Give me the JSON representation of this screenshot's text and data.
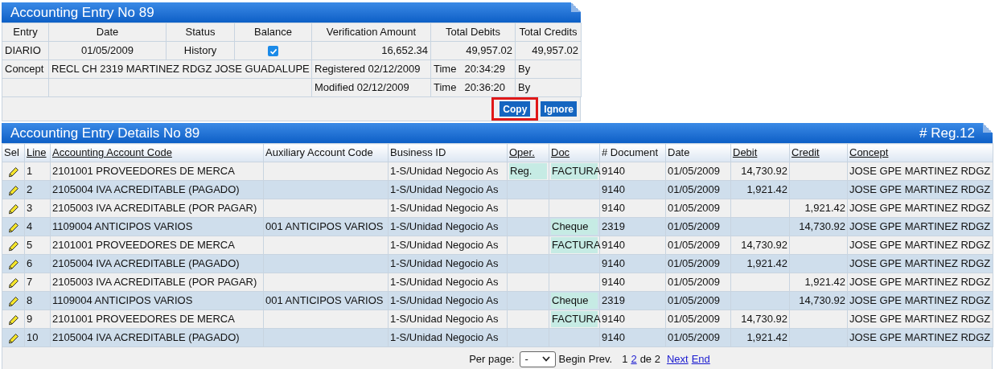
{
  "entry_panel": {
    "title": "Accounting Entry No 89",
    "columns": [
      "Entry",
      "Date",
      "Status",
      "Balance",
      "Verification Amount",
      "Total Debits",
      "Total Credits"
    ],
    "entry": "DIARIO",
    "date": "01/05/2009",
    "status": "History",
    "balanced": true,
    "verification_amount": "16,652.34",
    "total_debits": "49,957.02",
    "total_credits": "49,957.02",
    "concept_label": "Concept",
    "concept": "RECL CH 2319 MARTINEZ RDGZ JOSE GUADALUPE",
    "registered": "Registered 02/12/2009",
    "registered_time_label": "Time",
    "registered_time": "20:34:29",
    "registered_by": "By",
    "modified": "Modified 02/12/2009",
    "modified_time_label": "Time",
    "modified_time": "20:36:20",
    "modified_by": "By",
    "buttons": [
      {
        "label": "Copy",
        "highlighted": true
      },
      {
        "label": "Ignore",
        "highlighted": false
      }
    ]
  },
  "details_panel": {
    "title": "Accounting Entry Details No 89",
    "count": "# Reg.12",
    "columns": [
      {
        "label": "Sel",
        "sortable": false
      },
      {
        "label": "Line",
        "sortable": true
      },
      {
        "label": "Accounting Account Code",
        "sortable": true
      },
      {
        "label": "Auxiliary Account Code",
        "sortable": false
      },
      {
        "label": "Business ID",
        "sortable": false
      },
      {
        "label": "Oper.",
        "sortable": true
      },
      {
        "label": "Doc",
        "sortable": true
      },
      {
        "label": "# Document",
        "sortable": false
      },
      {
        "label": "Date",
        "sortable": false
      },
      {
        "label": "Debit",
        "sortable": true
      },
      {
        "label": "Credit",
        "sortable": true
      },
      {
        "label": "Concept",
        "sortable": true
      }
    ],
    "rows": [
      {
        "line": "1",
        "account": "2101001 PROVEEDORES DE MERCA",
        "auxiliary": "",
        "business": "1-S/Unidad Negocio As",
        "oper": "Reg.",
        "doc": "FACTURA",
        "document": "9140",
        "date": "01/05/2009",
        "debit": "14,730.92",
        "credit": "",
        "concept": "JOSE GPE MARTINEZ RDGZ"
      },
      {
        "line": "2",
        "account": "2105004 IVA ACREDITABLE (PAGADO)",
        "auxiliary": "",
        "business": "1-S/Unidad Negocio As",
        "oper": "",
        "doc": "",
        "document": "9140",
        "date": "01/05/2009",
        "debit": "1,921.42",
        "credit": "",
        "concept": "JOSE GPE MARTINEZ RDGZ"
      },
      {
        "line": "3",
        "account": "2105003 IVA ACREDITABLE (POR PAGAR)",
        "auxiliary": "",
        "business": "1-S/Unidad Negocio As",
        "oper": "",
        "doc": "",
        "document": "9140",
        "date": "01/05/2009",
        "debit": "",
        "credit": "1,921.42",
        "concept": "JOSE GPE MARTINEZ RDGZ"
      },
      {
        "line": "4",
        "account": "1109004 ANTICIPOS VARIOS",
        "auxiliary": "001 ANTICIPOS VARIOS",
        "business": "1-S/Unidad Negocio As",
        "oper": "",
        "doc": "Cheque",
        "document": "2319",
        "date": "01/05/2009",
        "debit": "",
        "credit": "14,730.92",
        "concept": "JOSE GPE MARTINEZ RDGZ"
      },
      {
        "line": "5",
        "account": "2101001 PROVEEDORES DE MERCA",
        "auxiliary": "",
        "business": "1-S/Unidad Negocio As",
        "oper": "",
        "doc": "FACTURA",
        "document": "9140",
        "date": "01/05/2009",
        "debit": "14,730.92",
        "credit": "",
        "concept": "JOSE GPE MARTINEZ RDGZ"
      },
      {
        "line": "6",
        "account": "2105004 IVA ACREDITABLE (PAGADO)",
        "auxiliary": "",
        "business": "1-S/Unidad Negocio As",
        "oper": "",
        "doc": "",
        "document": "9140",
        "date": "01/05/2009",
        "debit": "1,921.42",
        "credit": "",
        "concept": "JOSE GPE MARTINEZ RDGZ"
      },
      {
        "line": "7",
        "account": "2105003 IVA ACREDITABLE (POR PAGAR)",
        "auxiliary": "",
        "business": "1-S/Unidad Negocio As",
        "oper": "",
        "doc": "",
        "document": "9140",
        "date": "01/05/2009",
        "debit": "",
        "credit": "1,921.42",
        "concept": "JOSE GPE MARTINEZ RDGZ"
      },
      {
        "line": "8",
        "account": "1109004 ANTICIPOS VARIOS",
        "auxiliary": "001 ANTICIPOS VARIOS",
        "business": "1-S/Unidad Negocio As",
        "oper": "",
        "doc": "Cheque",
        "document": "2319",
        "date": "01/05/2009",
        "debit": "",
        "credit": "14,730.92",
        "concept": "JOSE GPE MARTINEZ RDGZ"
      },
      {
        "line": "9",
        "account": "2101001 PROVEEDORES DE MERCA",
        "auxiliary": "",
        "business": "1-S/Unidad Negocio As",
        "oper": "",
        "doc": "FACTURA",
        "document": "9140",
        "date": "01/05/2009",
        "debit": "14,730.92",
        "credit": "",
        "concept": "JOSE GPE MARTINEZ RDGZ"
      },
      {
        "line": "10",
        "account": "2105004 IVA ACREDITABLE (PAGADO)",
        "auxiliary": "",
        "business": "1-S/Unidad Negocio As",
        "oper": "",
        "doc": "",
        "document": "9140",
        "date": "01/05/2009",
        "debit": "1,921.42",
        "credit": "",
        "concept": "JOSE GPE MARTINEZ RDGZ"
      }
    ],
    "pagination": {
      "per_page_label": "Per page:",
      "per_page_value": "-",
      "begin": "Begin",
      "prev": "Prev.",
      "pages": [
        {
          "label": "1",
          "selected": true
        },
        {
          "label": "2",
          "selected": false
        }
      ],
      "of": "de 2",
      "next": "Next",
      "end": "End"
    }
  }
}
